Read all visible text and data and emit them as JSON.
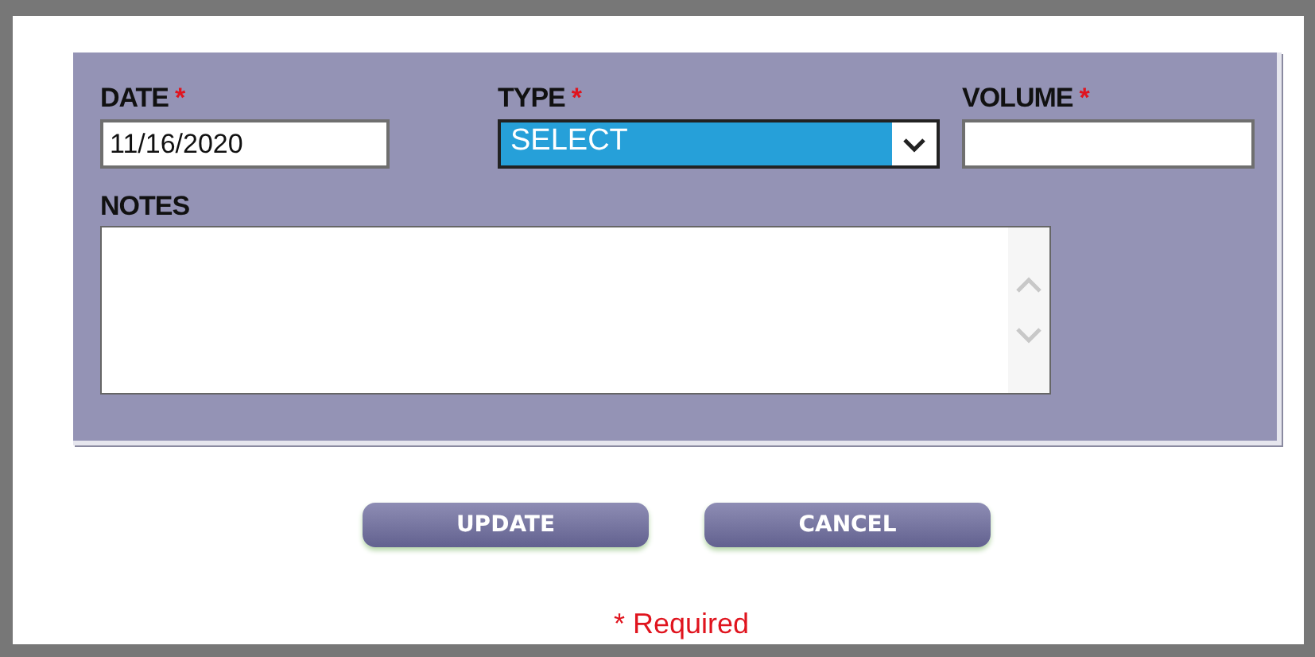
{
  "fields": [
    {
      "kind": "text",
      "label": "DATE",
      "required_mark": "*",
      "value": "11/16/2020"
    },
    {
      "kind": "select",
      "label": "TYPE",
      "required_mark": "*",
      "value": "SELECT"
    },
    {
      "kind": "text",
      "label": "VOLUME",
      "required_mark": "*"
    }
  ],
  "notes": {
    "label": "NOTES"
  },
  "buttons": [
    "UPDATE",
    "CANCEL"
  ],
  "footnote": "* Required"
}
